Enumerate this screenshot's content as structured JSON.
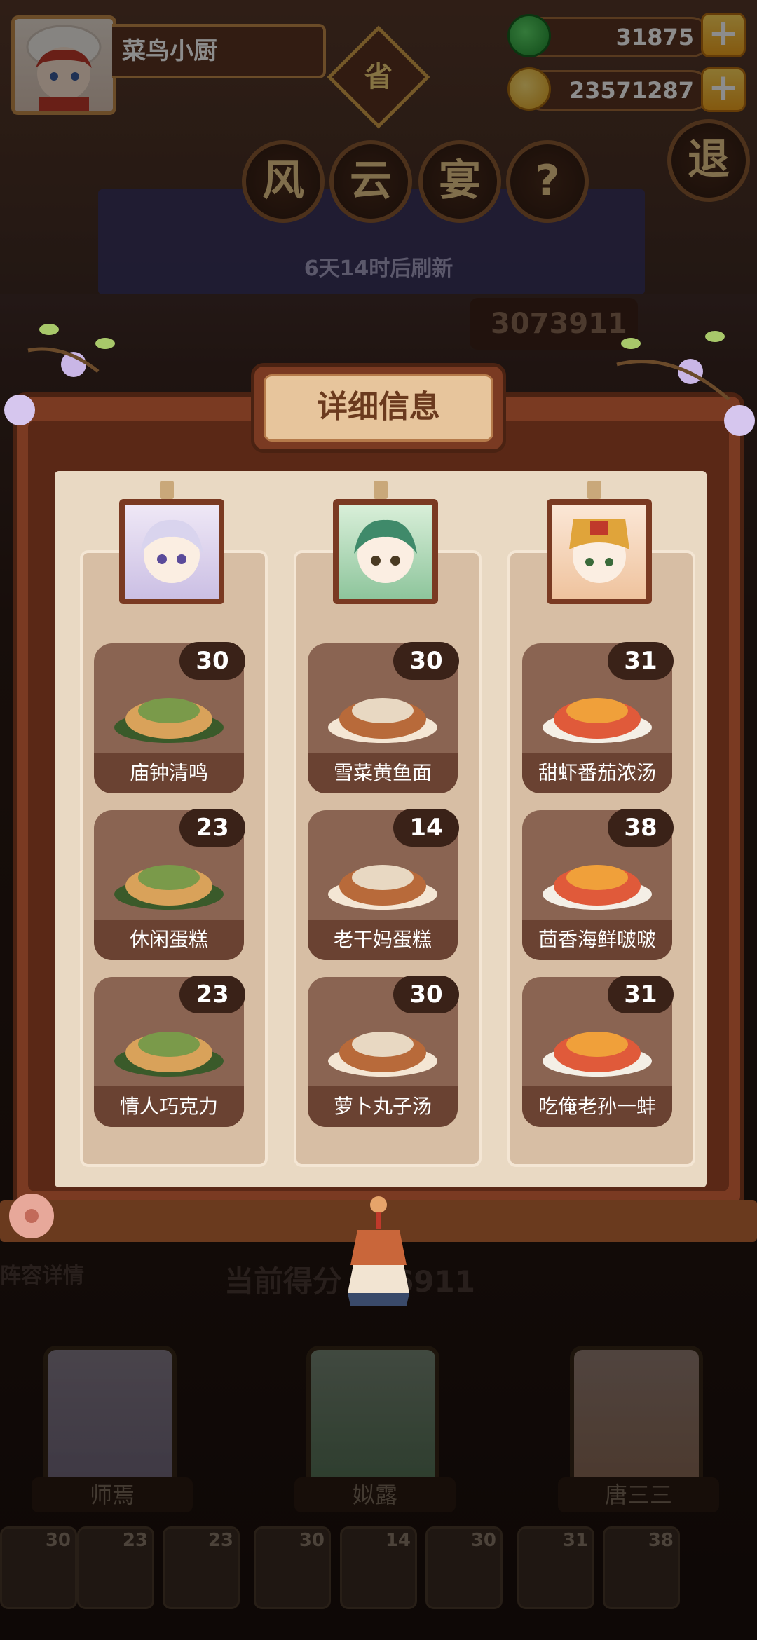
{
  "player": {
    "name": "菜鸟小厨"
  },
  "province_label": "省",
  "currency": {
    "jade": "31875",
    "coins": "23571287"
  },
  "event_title": [
    "风",
    "云",
    "宴"
  ],
  "help_label": "?",
  "exit_label": "退",
  "refresh_text": "6天14时后刷新",
  "top_score": "3073911",
  "background": {
    "lineup_label": "阵容详情",
    "current_score": "当前得分 396911"
  },
  "bottom_chars": [
    "师焉",
    "姒露",
    "唐三三"
  ],
  "bottom_dish_counts": [
    "30",
    "23",
    "23",
    "30",
    "14",
    "30",
    "31",
    "38"
  ],
  "panel": {
    "title": "详细信息"
  },
  "columns": [
    {
      "dishes": [
        {
          "name": "庙钟清鸣",
          "count": "30"
        },
        {
          "name": "休闲蛋糕",
          "count": "23"
        },
        {
          "name": "情人巧克力",
          "count": "23"
        }
      ]
    },
    {
      "dishes": [
        {
          "name": "雪菜黄鱼面",
          "count": "30"
        },
        {
          "name": "老干妈蛋糕",
          "count": "14"
        },
        {
          "name": "萝卜丸子汤",
          "count": "30"
        }
      ]
    },
    {
      "dishes": [
        {
          "name": "甜虾番茄浓汤",
          "count": "31"
        },
        {
          "name": "茴香海鲜啵啵",
          "count": "38"
        },
        {
          "name": "吃俺老孙一蚌",
          "count": "31"
        }
      ]
    }
  ],
  "colors": {
    "panel_frame": "#7a3a22",
    "panel_paper": "#e9d9c3",
    "badge": "#3a2218",
    "plus_button": "#f0a21c"
  }
}
